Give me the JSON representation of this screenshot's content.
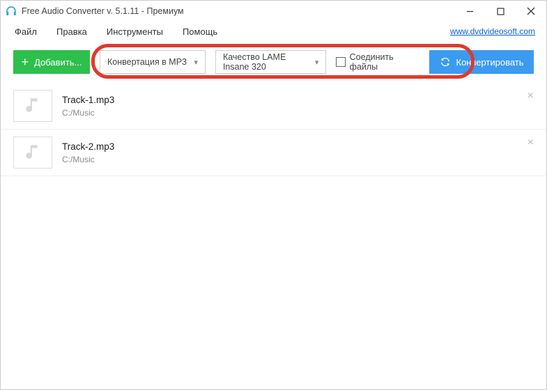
{
  "titlebar": {
    "title": "Free Audio Converter v. 5.1.11 - Премиум"
  },
  "menubar": {
    "items": [
      "Файл",
      "Правка",
      "Инструменты",
      "Помощь"
    ],
    "link": "www.dvdvideosoft.com"
  },
  "toolbar": {
    "add_label": "Добавить...",
    "format_selected": "Конвертация в MP3",
    "quality_selected": "Качество LAME Insane 320",
    "join_label": "Соединить файлы",
    "convert_label": "Конвертировать"
  },
  "files": [
    {
      "name": "Track-1.mp3",
      "path": "C:/Music"
    },
    {
      "name": "Track-2.mp3",
      "path": "C:/Music"
    }
  ]
}
